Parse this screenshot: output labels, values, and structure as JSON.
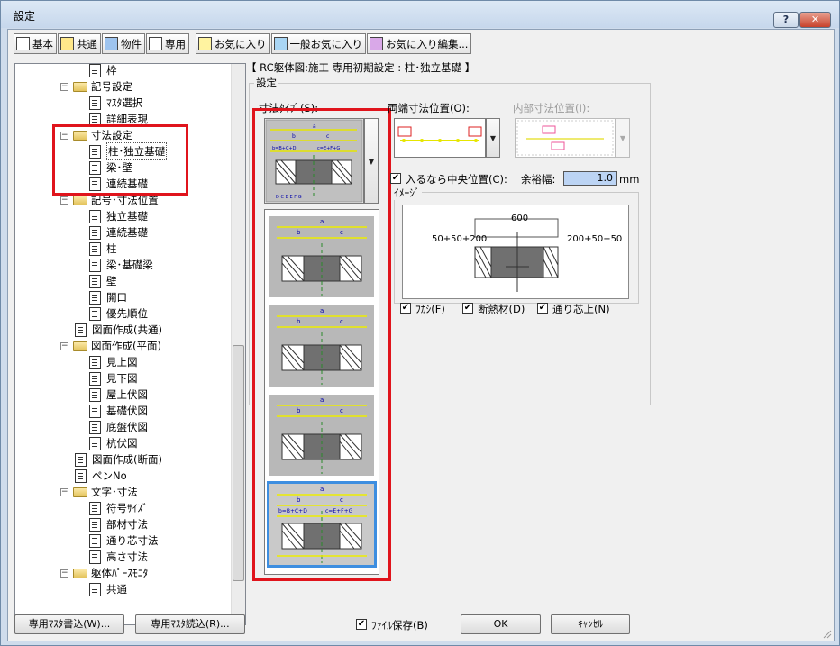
{
  "window": {
    "title": "設定"
  },
  "toolbar": {
    "buttons": [
      "基本",
      "共通",
      "物件",
      "専用",
      "お気に入り",
      "一般お気に入り",
      "お気に入り編集..."
    ]
  },
  "tree": {
    "items": [
      {
        "label": "枠",
        "type": "doc"
      },
      {
        "label": "記号設定",
        "type": "folder"
      },
      {
        "label": "ﾏｽﾀ選択",
        "type": "doc"
      },
      {
        "label": "詳細表現",
        "type": "doc"
      },
      {
        "label": "寸法設定",
        "type": "folder"
      },
      {
        "label": "柱･独立基礎",
        "type": "doc"
      },
      {
        "label": "梁･壁",
        "type": "doc"
      },
      {
        "label": "連続基礎",
        "type": "doc"
      },
      {
        "label": "記号･寸法位置",
        "type": "folder"
      },
      {
        "label": "独立基礎",
        "type": "doc"
      },
      {
        "label": "連続基礎",
        "type": "doc"
      },
      {
        "label": "柱",
        "type": "doc"
      },
      {
        "label": "梁･基礎梁",
        "type": "doc"
      },
      {
        "label": "壁",
        "type": "doc"
      },
      {
        "label": "開口",
        "type": "doc"
      },
      {
        "label": "優先順位",
        "type": "doc"
      },
      {
        "label": "図面作成(共通)",
        "type": "doc"
      },
      {
        "label": "図面作成(平面)",
        "type": "folder"
      },
      {
        "label": "見上図",
        "type": "doc"
      },
      {
        "label": "見下図",
        "type": "doc"
      },
      {
        "label": "屋上伏図",
        "type": "doc"
      },
      {
        "label": "基礎伏図",
        "type": "doc"
      },
      {
        "label": "底盤伏図",
        "type": "doc"
      },
      {
        "label": "杭伏図",
        "type": "doc"
      },
      {
        "label": "図面作成(断面)",
        "type": "doc"
      },
      {
        "label": "ペンNo",
        "type": "doc"
      },
      {
        "label": "文字･寸法",
        "type": "folder"
      },
      {
        "label": "符号ｻｲｽﾞ",
        "type": "doc"
      },
      {
        "label": "部材寸法",
        "type": "doc"
      },
      {
        "label": "通り芯寸法",
        "type": "doc"
      },
      {
        "label": "高さ寸法",
        "type": "doc"
      },
      {
        "label": "躯体ﾊﾟｰｽﾓﾆﾀ",
        "type": "folder"
      },
      {
        "label": "共通",
        "type": "doc"
      }
    ]
  },
  "main": {
    "heading": "【 RC躯体図:施工 専用初期設定 : 柱･独立基礎 】",
    "group_label": "設定",
    "dim_type_label": "寸法ﾀｲﾌﾟ(S):",
    "both_ends_label": "両端寸法位置(O):",
    "inner_dim_label": "内部寸法位置(I):",
    "center_check_label": "入るなら中央位置(C):",
    "margin_label": "余裕幅:",
    "margin_value": "1.0",
    "margin_unit": "mm",
    "image_label": "ｲﾒｰｼﾞ",
    "image_top": "600",
    "image_left": "50+50+200",
    "image_right": "200+50+50",
    "checks": [
      "ﾌｶｼ(F)",
      "断熱材(D)",
      "通り芯上(N)"
    ],
    "thumb_labels": {
      "a": "a",
      "b": "b",
      "c": "c",
      "formula_b": "b=B+C+D",
      "formula_c": "c=E+F+G",
      "bottom": [
        "D",
        "C",
        "B",
        "E",
        "F",
        "G"
      ]
    }
  },
  "footer": {
    "write_master": "専用ﾏｽﾀ書込(W)...",
    "read_master": "専用ﾏｽﾀ読込(R)...",
    "file_save": "ﾌｧｲﾙ保存(B)",
    "ok": "OK",
    "cancel": "ｷｬﾝｾﾙ"
  },
  "colors": {
    "highlight": "#e0141c",
    "selection": "#3d8ee0",
    "field": "#bcd4f4"
  }
}
